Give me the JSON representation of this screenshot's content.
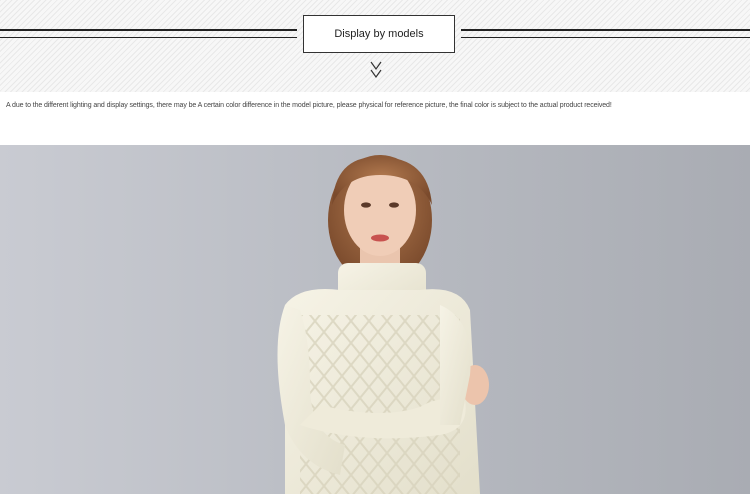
{
  "section": {
    "title": "Display by models",
    "divider_icon": "double-chevron-down-icon"
  },
  "disclaimer": "A due to the different lighting and display settings, there may be A certain color difference in the model picture, please physical for reference picture, the final color is subject to the actual product received!",
  "model_photo": {
    "subject": "model wearing cream cable-knit turtleneck sweater",
    "background_color": "#b9bcc3",
    "sweater_color": "#f2efdf"
  }
}
